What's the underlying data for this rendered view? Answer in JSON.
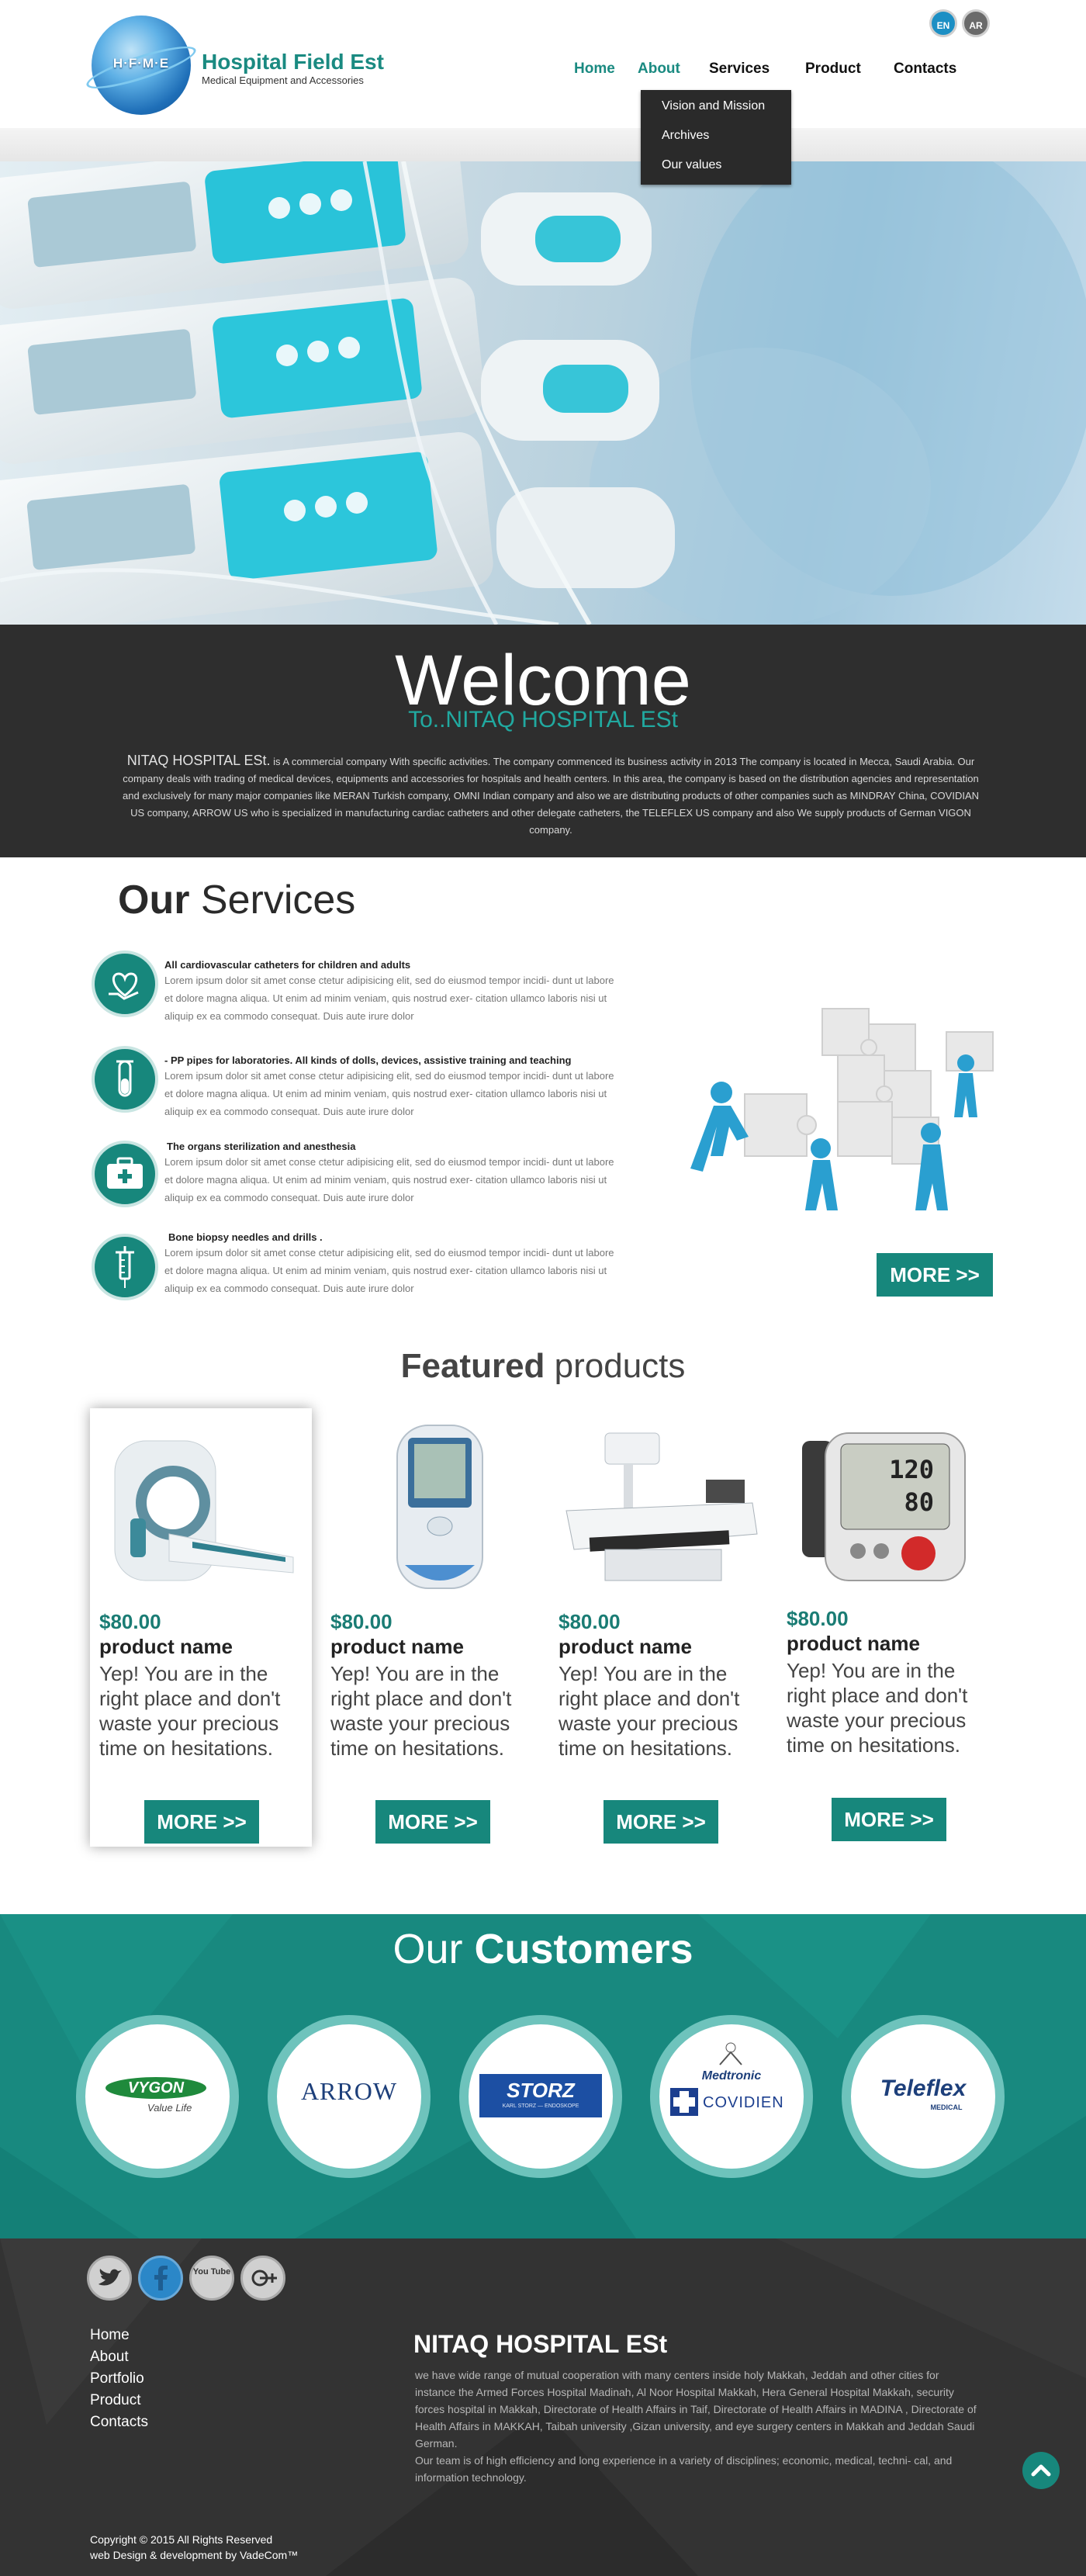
{
  "header": {
    "logo_letters": "H·F·M·E",
    "logo_title": "Hospital Field Est",
    "logo_subtitle": "Medical Equipment and Accessories",
    "lang_en": "EN",
    "lang_ar": "AR"
  },
  "nav": {
    "home": "Home",
    "about": "About",
    "services": "Services",
    "product": "Product",
    "contacts": "Contacts",
    "about_menu": [
      "Vision and Mission",
      "Archives",
      "Our values"
    ]
  },
  "welcome": {
    "title": "Welcome",
    "subtitle": "To..NITAQ HOSPITAL  ESt",
    "lead": "NITAQ HOSPITAL  ESt.",
    "body": " is A commercial company With specific activities. The company commenced its business activity in 2013 The company is located in Mecca, Saudi Arabia. Our company deals with trading of  medical devices, equipments  and accessories for  hospitals and health centers. In this area, the company is based on the distribution agencies and representation and exclusively for many major companies like  MERAN Turkish company, OMNI Indian company and also we are distributing products of other companies such as MINDRAY China,  COVIDIAN US company,  ARROW US who is specialized in manufacturing cardiac catheters and other delegate catheters,  the  TELEFLEX US company and also We supply products of German VIGON company."
  },
  "services": {
    "title_bold": "Our",
    "title_light": " Services",
    "more": "MORE >>",
    "items": [
      {
        "icon": "heart-hand-icon",
        "title": "All cardiovascular catheters for children and adults",
        "text": "Lorem ipsum dolor sit amet conse ctetur adipisicing elit, sed do eiusmod tempor incidi- dunt ut labore et dolore magna aliqua. Ut enim ad minim veniam, quis nostrud exer- citation ullamco laboris nisi ut aliquip ex ea commodo consequat. Duis aute irure dolor"
      },
      {
        "icon": "test-tube-icon",
        "title": "- PP pipes for laboratories. All kinds of dolls, devices, assistive training and teaching",
        "text": "Lorem ipsum dolor sit amet conse ctetur adipisicing elit, sed do eiusmod tempor incidi- dunt ut labore et dolore magna aliqua. Ut enim ad minim veniam, quis nostrud exer- citation ullamco laboris nisi ut aliquip ex ea commodo consequat. Duis aute irure dolor"
      },
      {
        "icon": "first-aid-kit-icon",
        "title": "The organs sterilization and anesthesia",
        "text": "Lorem ipsum dolor sit amet conse ctetur adipisicing elit, sed do eiusmod tempor incidi- dunt ut labore et dolore magna aliqua. Ut enim ad minim veniam, quis nostrud exer- citation ullamco laboris nisi ut aliquip ex ea commodo consequat. Duis aute irure dolor"
      },
      {
        "icon": "syringe-icon",
        "title": "Bone biopsy needles and drills .",
        "text": "Lorem ipsum dolor sit amet conse ctetur adipisicing elit, sed do eiusmod tempor incidi- dunt ut labore et dolore magna aliqua. Ut enim ad minim veniam, quis nostrud exer- citation ullamco laboris nisi ut aliquip ex ea commodo consequat. Duis aute irure dolor"
      }
    ]
  },
  "featured": {
    "title_bold": "Featured",
    "title_light": " products",
    "products": [
      {
        "image": "ct-scanner",
        "price": "$80.00",
        "name": "product name",
        "desc": "Yep! You are in the right place and don't waste your precious time on hesitations.",
        "more": "MORE >>"
      },
      {
        "image": "glucometer",
        "price": "$80.00",
        "name": "product name",
        "desc": "Yep! You are in the right place and don't waste your precious time on hesitations.",
        "more": "MORE >>"
      },
      {
        "image": "x-ray-machine",
        "price": "$80.00",
        "name": "product name",
        "desc": "Yep! You are in the right place and don't waste your precious time on hesitations.",
        "more": "MORE >>"
      },
      {
        "image": "blood-pressure-monitor",
        "price": "$80.00",
        "name": "product name",
        "desc": "Yep! You are in the right place and don't waste your precious time on hesitations.",
        "more": "MORE >>"
      }
    ],
    "bp_readings": {
      "sys": "120",
      "dia": "80"
    }
  },
  "customers": {
    "title_light": "Our ",
    "title_bold": "Customers",
    "logos": [
      {
        "name": "VYGON",
        "tagline": "Value Life"
      },
      {
        "name": "ARROW"
      },
      {
        "name": "STORZ",
        "tagline": "KARL STORZ — ENDOSKOPE"
      },
      {
        "name": "Medtronic",
        "tagline": "COVIDIEN"
      },
      {
        "name": "Teleflex",
        "tagline": "MEDICAL"
      }
    ]
  },
  "footer": {
    "social": [
      "twitter-icon",
      "facebook-icon",
      "youtube-icon",
      "google-plus-icon"
    ],
    "youtube_label": "You Tube",
    "links": [
      "Home",
      "About",
      "Portfolio",
      "Product",
      "Contacts"
    ],
    "title": "NITAQ HOSPITAL  ESt",
    "text1": "we have wide range of mutual cooperation with many centers inside holy Makkah, Jeddah and other cities for instance the Armed Forces Hospital Madinah,  Al Noor Hospital Makkah, Hera General Hospital Makkah, security forces hospital in Makkah, Directorate of Health Affairs in Taif,  Directorate of Health Affairs in MADINA , Directorate of Health Affairs in MAKKAH, Taibah university ,Gizan  university, and eye surgery centers in Makkah and Jeddah Saudi German.",
    "text2": "Our team  is of high efficiency and long experience in a variety of disciplines; economic, medical, techni- cal, and information technology.",
    "copyright": "Copyright © 2015 All Rights Reserved",
    "credit": "web Design & development by VadeCom™"
  },
  "colors": {
    "accent": "#17877c",
    "dark": "#2e2e2e",
    "footer": "#333333",
    "link_active": "#1a8a81"
  }
}
